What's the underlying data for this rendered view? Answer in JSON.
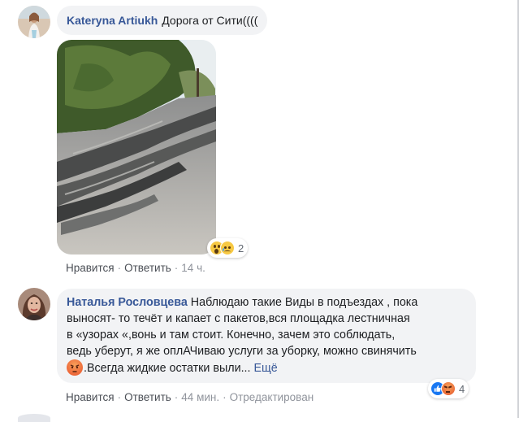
{
  "comment1": {
    "author": "Kateryna Artiukh",
    "text": "Дорога от Сити((((",
    "reactions": {
      "icons": [
        "wow-icon",
        "sad-icon"
      ],
      "count": "2"
    },
    "actions": {
      "like": "Нравится",
      "reply": "Ответить",
      "time": "14 ч."
    }
  },
  "comment2": {
    "author": "Наталья Рословцева",
    "text_line1": "Наблюдаю такие Виды в подъездах , пока",
    "text_line2": "выносят- то течёт и капает с пакетов,вся площадка лестничная",
    "text_line3": "в «узорах «,вонь и там стоит. Конечно, зачем это соблюдать,",
    "text_line4": "ведь уберут, я же оплАЧиваю услуги за уборку, можно свинячить",
    "text_line5": ".Всегда жидкие остатки выли...",
    "see_more": "Ещё",
    "reactions": {
      "icons": [
        "like-icon",
        "angry-icon"
      ],
      "count": "4"
    },
    "actions": {
      "like": "Нравится",
      "reply": "Ответить",
      "time": "44 мин.",
      "edited": "Отредактирован"
    }
  },
  "colors": {
    "author": "#385898",
    "bubble": "#f2f3f5",
    "meta": "#90949c",
    "like": "#1877f2",
    "angry": "#f07340"
  }
}
